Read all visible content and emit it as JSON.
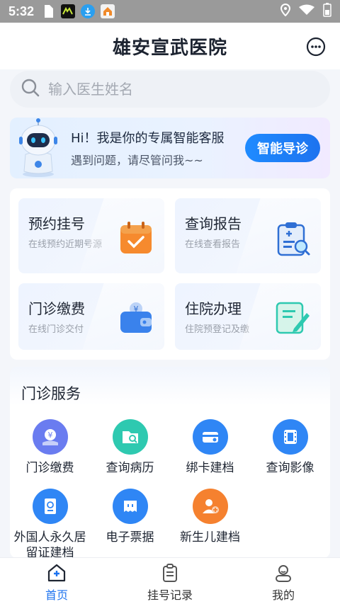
{
  "status_bar": {
    "time": "5:32"
  },
  "header": {
    "title": "雄安宣武医院"
  },
  "search": {
    "placeholder": "输入医生姓名"
  },
  "ai_banner": {
    "title": "Hi！我是你的专属智能客服",
    "subtitle": "遇到问题，请尽管问我~~",
    "button_label": "智能导诊"
  },
  "quick_cards": [
    {
      "title": "预约挂号",
      "desc": "在线预约近期号源",
      "icon": "calendar-icon"
    },
    {
      "title": "查询报告",
      "desc": "在线查看报告",
      "icon": "report-icon"
    },
    {
      "title": "门诊缴费",
      "desc": "在线门诊交付",
      "icon": "wallet-icon"
    },
    {
      "title": "住院办理",
      "desc": "住院预登记及缴",
      "icon": "admission-icon"
    }
  ],
  "services": {
    "title": "门诊服务",
    "items": [
      {
        "label": "门诊缴费",
        "icon": "payment-icon",
        "color": "#6a7cf0"
      },
      {
        "label": "查询病历",
        "icon": "folder-search-icon",
        "color": "#2ec9b0"
      },
      {
        "label": "绑卡建档",
        "icon": "card-icon",
        "color": "#2f86f5"
      },
      {
        "label": "查询影像",
        "icon": "film-icon",
        "color": "#2f86f5"
      },
      {
        "label": "外国人永久居留证建档",
        "icon": "passport-icon",
        "color": "#2f86f5"
      },
      {
        "label": "电子票据",
        "icon": "ticket-icon",
        "color": "#2f86f5"
      },
      {
        "label": "新生儿建档",
        "icon": "newborn-icon",
        "color": "#f5812f"
      }
    ]
  },
  "tabbar": {
    "items": [
      {
        "label": "首页",
        "icon": "home-icon",
        "active": true
      },
      {
        "label": "挂号记录",
        "icon": "clipboard-icon",
        "active": false
      },
      {
        "label": "我的",
        "icon": "profile-icon",
        "active": false
      }
    ]
  },
  "colors": {
    "accent": "#1d73ef",
    "orange": "#f5812f",
    "teal": "#2ec9b0"
  }
}
